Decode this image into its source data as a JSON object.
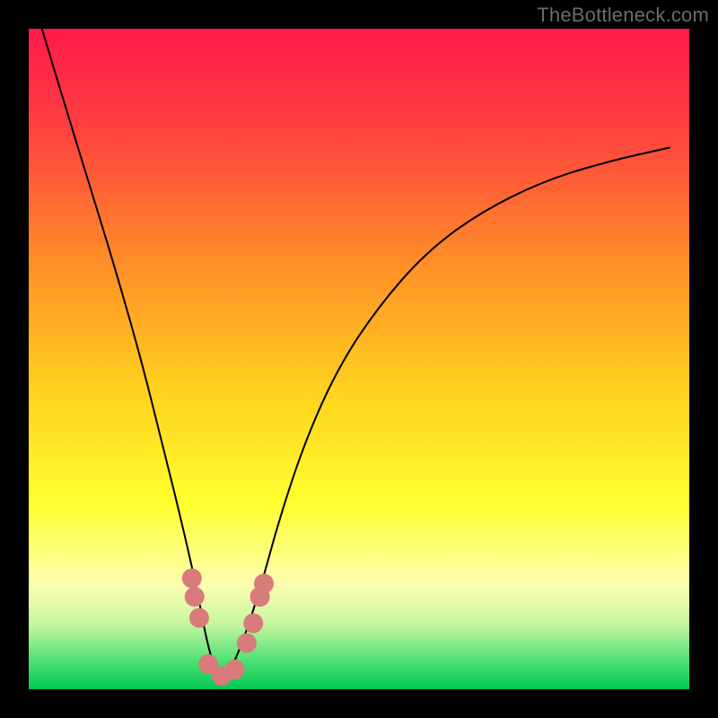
{
  "watermark": "TheBottleneck.com",
  "chart_data": {
    "type": "line",
    "title": "",
    "xlabel": "",
    "ylabel": "",
    "xlim": [
      0,
      1
    ],
    "ylim": [
      0,
      1
    ],
    "background_gradient_stops": [
      {
        "offset": 0.0,
        "color": "#ff1a4b"
      },
      {
        "offset": 0.15,
        "color": "#ff4040"
      },
      {
        "offset": 0.35,
        "color": "#ff8c28"
      },
      {
        "offset": 0.55,
        "color": "#ffd21e"
      },
      {
        "offset": 0.72,
        "color": "#ffff2e"
      },
      {
        "offset": 0.84,
        "color": "#fdfdb0"
      },
      {
        "offset": 0.9,
        "color": "#c8f6a0"
      },
      {
        "offset": 0.95,
        "color": "#5de47a"
      },
      {
        "offset": 1.0,
        "color": "#00c851"
      }
    ],
    "series": [
      {
        "name": "bottleneck-curve",
        "stroke": "#000000",
        "stroke_width": 2,
        "x": [
          0.02,
          0.05,
          0.09,
          0.13,
          0.17,
          0.2,
          0.23,
          0.255,
          0.27,
          0.285,
          0.3,
          0.32,
          0.35,
          0.38,
          0.42,
          0.47,
          0.53,
          0.6,
          0.68,
          0.78,
          0.88,
          0.97
        ],
        "y": [
          1.0,
          0.9,
          0.77,
          0.64,
          0.5,
          0.38,
          0.26,
          0.15,
          0.07,
          0.02,
          0.02,
          0.06,
          0.15,
          0.26,
          0.38,
          0.49,
          0.58,
          0.66,
          0.72,
          0.77,
          0.8,
          0.82
        ]
      }
    ],
    "markers": {
      "name": "highlight-dots",
      "color": "#d97b7b",
      "radius": 11,
      "points": [
        {
          "x": 0.247,
          "y": 0.168
        },
        {
          "x": 0.251,
          "y": 0.14
        },
        {
          "x": 0.258,
          "y": 0.108
        },
        {
          "x": 0.272,
          "y": 0.038
        },
        {
          "x": 0.292,
          "y": 0.02
        },
        {
          "x": 0.312,
          "y": 0.03
        },
        {
          "x": 0.33,
          "y": 0.07
        },
        {
          "x": 0.34,
          "y": 0.1
        },
        {
          "x": 0.35,
          "y": 0.14
        },
        {
          "x": 0.356,
          "y": 0.16
        }
      ]
    }
  }
}
